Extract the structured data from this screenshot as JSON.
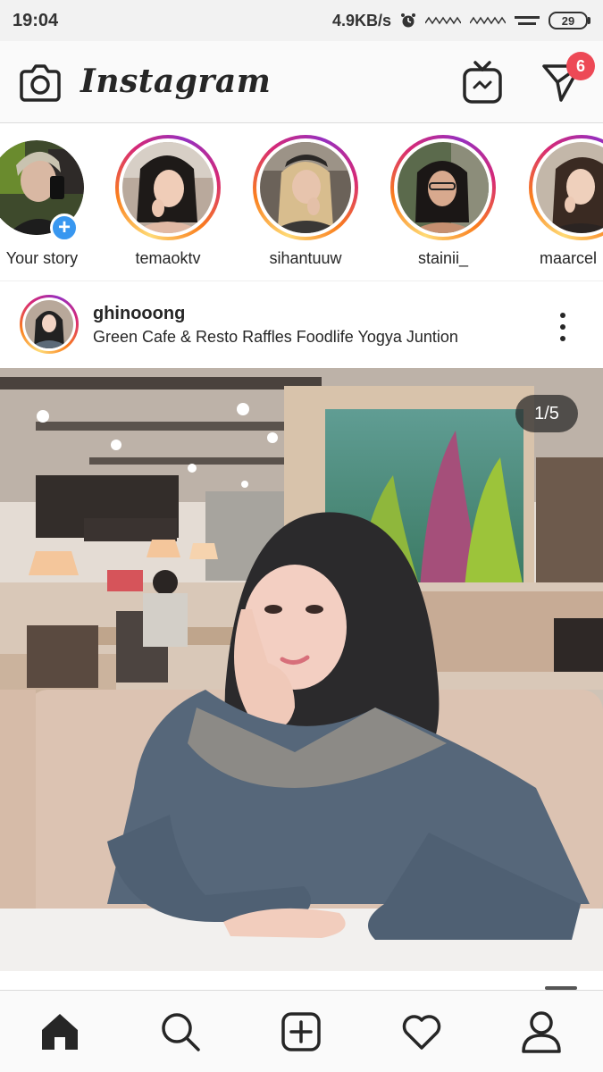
{
  "status_bar": {
    "time": "19:04",
    "network_speed": "4.9KB/s",
    "battery_level": "29",
    "icons": [
      "alarm-icon",
      "signal-icon",
      "signal-icon",
      "wifi-icon",
      "battery-icon"
    ]
  },
  "header": {
    "logo_text": "Instagram",
    "camera_icon": "camera-icon",
    "igtv_icon": "igtv-icon",
    "direct_icon": "direct-message-icon",
    "direct_badge": "6"
  },
  "stories": [
    {
      "username": "Your story",
      "own": true
    },
    {
      "username": "temaoktv",
      "own": false
    },
    {
      "username": "sihantuuw",
      "own": false
    },
    {
      "username": "stainii_",
      "own": false
    },
    {
      "username": "maarcel",
      "own": false
    }
  ],
  "post": {
    "username": "ghinooong",
    "location": "Green Cafe & Resto Raffles Foodlife Yogya Juntion",
    "page_counter": "1/5",
    "current_image": 1,
    "total_images": 5
  },
  "bottom_nav": [
    {
      "icon": "home-icon",
      "active": true
    },
    {
      "icon": "search-icon",
      "active": false
    },
    {
      "icon": "add-post-icon",
      "active": false
    },
    {
      "icon": "activity-heart-icon",
      "active": false
    },
    {
      "icon": "profile-icon",
      "active": false
    }
  ],
  "colors": {
    "badge": "#ed4956",
    "story_add": "#3897f0",
    "icon": "#262626"
  }
}
